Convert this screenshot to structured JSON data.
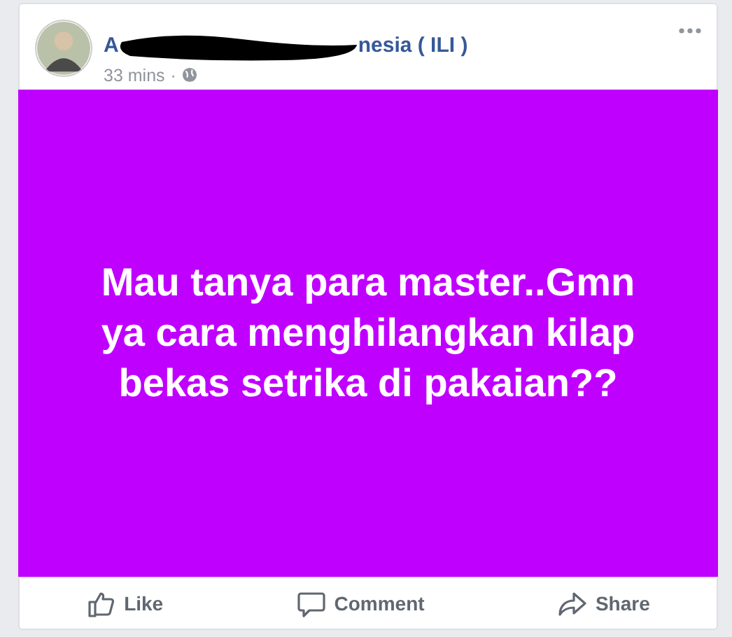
{
  "post": {
    "author_visible_start": "A",
    "author_visible_end": "nesia ( ILI )",
    "time": "33 mins",
    "separator": "·",
    "text": "Mau tanya para master..Gmn ya cara menghilangkan kilap bekas setrika di pakaian??",
    "actions": [
      {
        "kind": "like",
        "label": "Like"
      },
      {
        "kind": "comment",
        "label": "Comment"
      },
      {
        "kind": "share",
        "label": "Share"
      }
    ]
  }
}
